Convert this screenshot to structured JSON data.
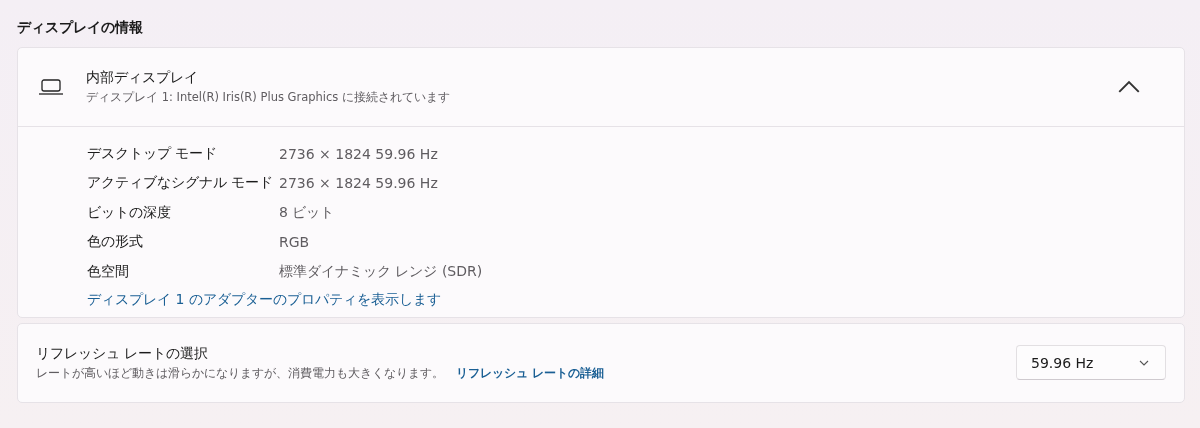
{
  "section_title": "ディスプレイの情報",
  "display": {
    "name": "内部ディスプレイ",
    "description": "ディスプレイ 1: Intel(R) Iris(R) Plus Graphics に接続されています",
    "expanded": true,
    "properties": [
      {
        "label": "デスクトップ モード",
        "value": "2736 × 1824 59.96 Hz"
      },
      {
        "label": "アクティブなシグナル モード",
        "value": "2736 × 1824 59.96 Hz"
      },
      {
        "label": "ビットの深度",
        "value": "8 ビット"
      },
      {
        "label": "色の形式",
        "value": "RGB"
      },
      {
        "label": "色空間",
        "value": "標準ダイナミック レンジ (SDR)"
      }
    ],
    "link": "ディスプレイ 1 のアダプターのプロパティを表示します"
  },
  "refresh_rate": {
    "title": "リフレッシュ レートの選択",
    "description": "レートが高いほど動きは滑らかになりますが、消費電力も大きくなります。",
    "link": "リフレッシュ レートの詳細",
    "dropdown": {
      "value": "59.96 Hz"
    }
  }
}
